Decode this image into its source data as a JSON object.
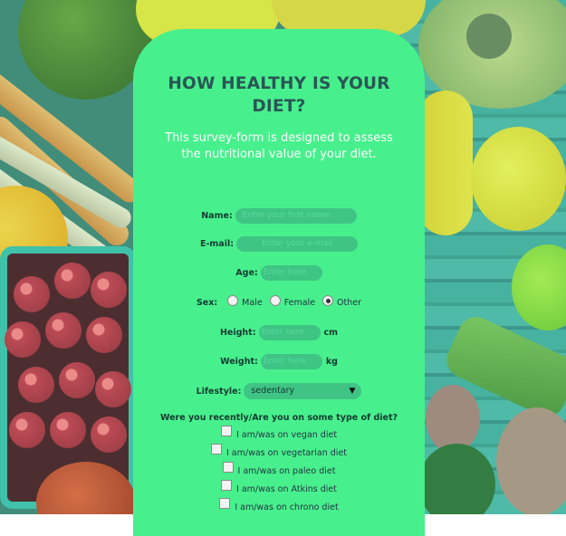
{
  "form": {
    "title": "HOW HEALTHY IS YOUR DIET?",
    "description": "This survey-form is designed to assess the nutritional value of your diet.",
    "name_label": "Name:",
    "name_placeholder": "Enter your first name",
    "email_label": "E-mail:",
    "email_placeholder": "Enter your e-mail",
    "age_label": "Age:",
    "age_placeholder": "Enter here",
    "sex_label": "Sex:",
    "sex_options": [
      "Male",
      "Female",
      "Other"
    ],
    "sex_selected": "Other",
    "height_label": "Height:",
    "height_placeholder": "Enter here",
    "height_unit": "cm",
    "weight_label": "Weight:",
    "weight_placeholder": "Enter here",
    "weight_unit": "kg",
    "lifestyle_label": "Lifestyle:",
    "lifestyle_value": "sedentary",
    "diet_question": "Were you recently/Are you on some type of diet?",
    "diet_options": [
      "I am/was on vegan diet",
      "I am/was on vegetarian diet",
      "I am/was on paleo diet",
      "I am/was on Atkins diet",
      "I am/was on chrono diet"
    ]
  },
  "colors": {
    "card": "#47f08c",
    "field": "#3fc485",
    "title": "#2b5556"
  }
}
